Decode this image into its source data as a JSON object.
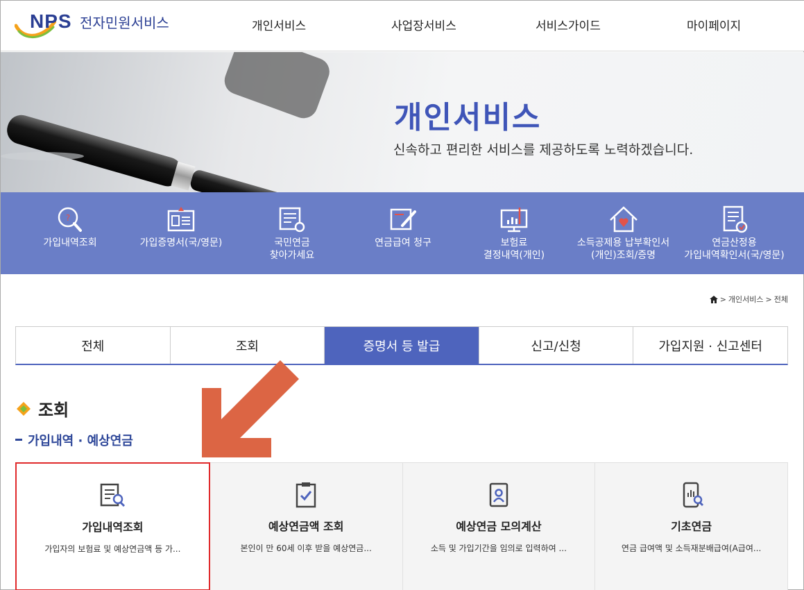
{
  "header": {
    "logo_text": "NPS",
    "logo_sub": "전자민원서비스",
    "nav": [
      "개인서비스",
      "사업장서비스",
      "서비스가이드",
      "마이페이지"
    ]
  },
  "hero": {
    "title": "개인서비스",
    "description": "신속하고 편리한 서비스를 제공하도록 노력하겠습니다."
  },
  "quick_links": [
    {
      "label": "가입내역조회",
      "icon": "magnifier-icon"
    },
    {
      "label": "가입증명서(국/영문)",
      "icon": "id-card-icon"
    },
    {
      "label": "국민연금\n찾아가세요",
      "icon": "document-search-icon"
    },
    {
      "label": "연금급여 청구",
      "icon": "pen-document-icon"
    },
    {
      "label": "보험료\n결정내역(개인)",
      "icon": "monitor-chart-icon"
    },
    {
      "label": "소득공제용 납부확인서\n(개인)조회/증명",
      "icon": "house-icon"
    },
    {
      "label": "연금산정용\n가입내역확인서(국/영문)",
      "icon": "certificate-icon"
    }
  ],
  "breadcrumb": {
    "home": "home-icon",
    "items": [
      "개인서비스",
      "전체"
    ]
  },
  "tabs": [
    {
      "label": "전체",
      "active": false
    },
    {
      "label": "조회",
      "active": false
    },
    {
      "label": "증명서 등 발급",
      "active": true
    },
    {
      "label": "신고/신청",
      "active": false
    },
    {
      "label": "가입지원 · 신고센터",
      "active": false
    }
  ],
  "section": {
    "title": "조회",
    "subtitle": "가입내역 · 예상연금"
  },
  "cards": [
    {
      "title": "가입내역조회",
      "desc": "가입자의 보험료 및 예상연금액 등 가...",
      "icon": "document-search-icon",
      "highlighted": true
    },
    {
      "title": "예상연금액 조회",
      "desc": "본인이 만 60세 이후 받을 예상연금...",
      "icon": "clipboard-check-icon",
      "highlighted": false
    },
    {
      "title": "예상연금 모의계산",
      "desc": "소득 및 가입기간을 임의로 입력하여 ...",
      "icon": "profile-badge-icon",
      "highlighted": false
    },
    {
      "title": "기초연금",
      "desc": "연금 급여액 및 소득재분배급여(A급여...",
      "icon": "phone-search-icon",
      "highlighted": false
    }
  ],
  "colors": {
    "brand": "#2a3e93",
    "accent": "#4e64bd",
    "quickbar": "#6a7ec7",
    "highlight": "#e0292b",
    "arrow": "#dc6544"
  }
}
